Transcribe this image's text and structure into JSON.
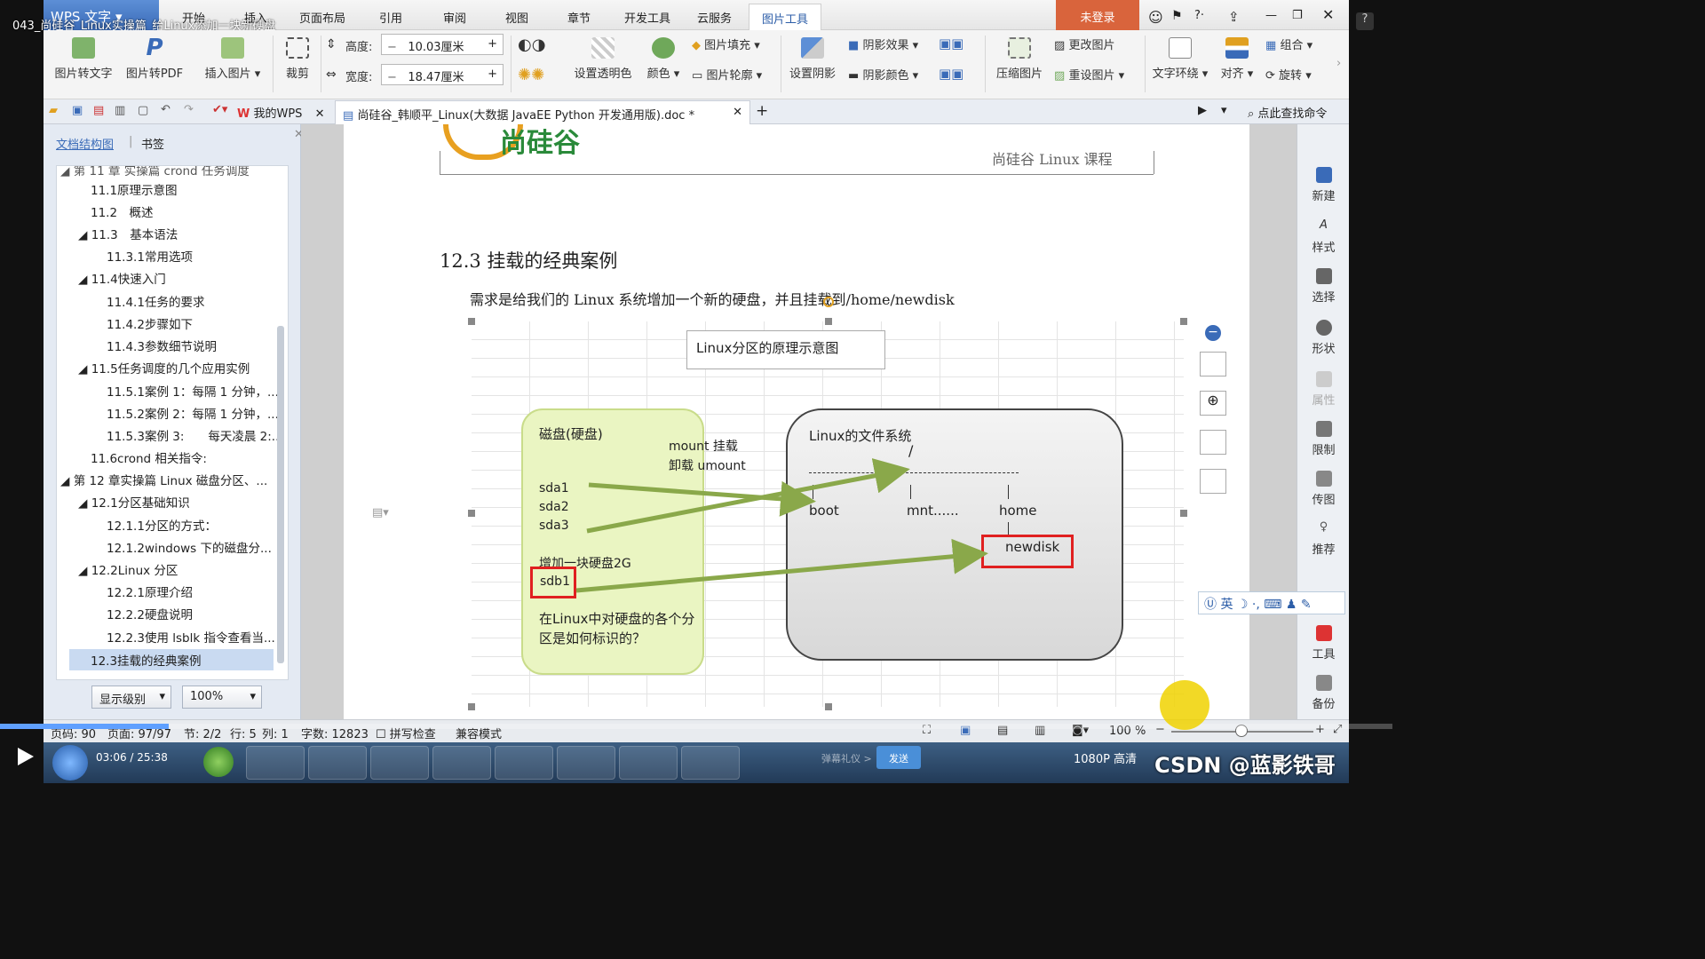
{
  "video": {
    "title": "043_尚硅谷_Linux实操篇_给Linux添加一块新硬盘",
    "time_current": "03:06",
    "time_total": "25:38",
    "quality": "1080P 高清",
    "watermark": "CSDN @蓝影铁哥",
    "send_label": "发送",
    "danmaku_placeholder": "弹幕礼仪 >"
  },
  "app": {
    "name": "WPS 文字",
    "login": "未登录",
    "menus": [
      "开始",
      "插入",
      "页面布局",
      "引用",
      "审阅",
      "视图",
      "章节",
      "开发工具",
      "云服务",
      "图片工具"
    ],
    "active_menu": "图片工具"
  },
  "ribbon": {
    "pic_to_text": "图片转文字",
    "pic_to_pdf": "图片转PDF",
    "insert_pic": "插入图片",
    "crop": "裁剪",
    "height_label": "高度:",
    "height_value": "10.03厘米",
    "width_label": "宽度:",
    "width_value": "18.47厘米",
    "transparent": "设置透明色",
    "color": "颜色",
    "fill": "图片填充",
    "outline": "图片轮廓",
    "set_shadow": "设置阴影",
    "shadow_effect": "阴影效果",
    "shadow_color": "阴影颜色",
    "compress": "压缩图片",
    "change_pic": "更改图片",
    "reset_pic": "重设图片",
    "text_wrap": "文字环绕",
    "align": "对齐",
    "group": "组合",
    "rotate": "旋转"
  },
  "tabs": {
    "my_wps": "我的WPS",
    "doc": "尚硅谷_韩顺平_Linux(大数据 JavaEE Python 开发通用版).doc *",
    "search_cmd": "点此查找命令"
  },
  "nav": {
    "tab_outline": "文档结构图",
    "tab_bookmark": "书签",
    "items": [
      "第 11 章 实操篇 crond 任务调度",
      "11.1原理示意图",
      "11.2　概述",
      "11.3　基本语法",
      "11.3.1常用选项",
      "11.4快速入门",
      "11.4.1任务的要求",
      "11.4.2步骤如下",
      "11.4.3参数细节说明",
      "11.5任务调度的几个应用实例",
      "11.5.1案例 1：每隔 1 分钟，...",
      "11.5.2案例 2：每隔 1 分钟，...",
      "11.5.3案例 3:　　每天凌晨 2:...",
      "11.6crond 相关指令:",
      "第 12 章实操篇 Linux 磁盘分区、...",
      "12.1分区基础知识",
      "12.1.1分区的方式：",
      "12.1.2windows 下的磁盘分...",
      "12.2Linux 分区",
      "12.2.1原理介绍",
      "12.2.2硬盘说明",
      "12.2.3使用 lsblk 指令查看当...",
      "12.3挂载的经典案例"
    ],
    "level_label": "显示级别",
    "zoom_label": "100%"
  },
  "page": {
    "header_brand": "尚硅谷",
    "header_right": "尚硅谷 Linux 课程",
    "section_title": "12.3  挂载的经典案例",
    "body_text": "需求是给我们的 Linux 系统增加一个新的硬盘，并且挂载到/home/newdisk",
    "diagram": {
      "title": "Linux分区的原理示意图",
      "disk_label": "磁盘(硬盘)",
      "mount_label": "mount 挂载",
      "umount_label": "卸载 umount",
      "parts": [
        "sda1",
        "sda2",
        "sda3"
      ],
      "add_disk": "增加一块硬盘2G",
      "new_part": "sdb1",
      "question": "在Linux中对硬盘的各个分区是如何标识的？",
      "fs_label": "Linux的文件系统",
      "root": "/",
      "dirs": [
        "boot",
        "mnt......",
        "home"
      ],
      "newdisk": "newdisk"
    }
  },
  "right_panel": [
    "新建",
    "样式",
    "选择",
    "形状",
    "属性",
    "限制",
    "传图",
    "推荐",
    "工具",
    "备份"
  ],
  "status": {
    "page_code": "页码: 90",
    "page": "页面: 97/97",
    "section": "节: 2/2",
    "row": "行: 5",
    "col": "列: 1",
    "words": "字数: 12823",
    "spell": "拼写检查",
    "compat": "兼容模式",
    "zoom": "100 %"
  },
  "colors": {
    "accent": "#3a6bb8",
    "red_box": "#e02020",
    "green_arrow": "#8aa84a",
    "disk_fill": "#eaf5c2"
  }
}
